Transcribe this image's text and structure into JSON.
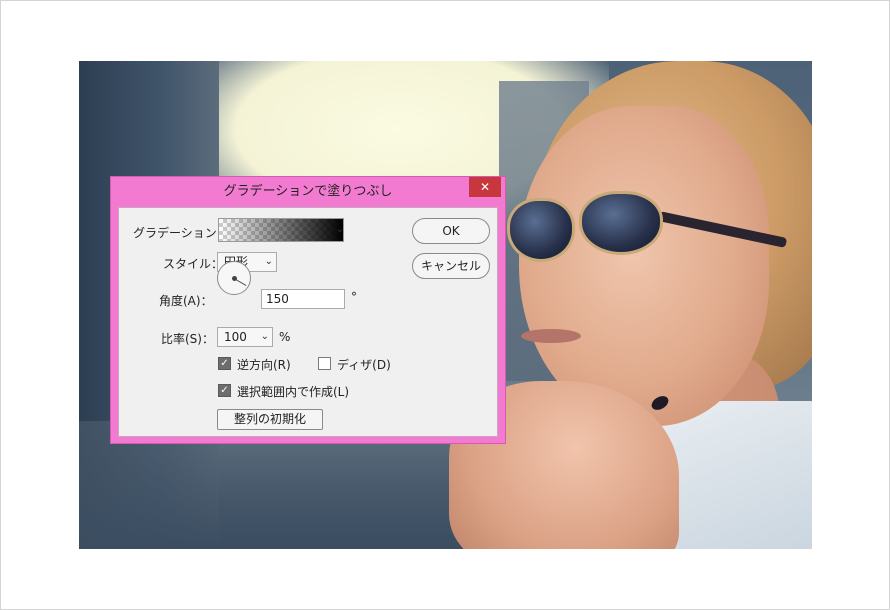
{
  "dialog": {
    "title": "グラデーションで塗りつぶし",
    "close_glyph": "✕",
    "gradient_label": "グラデーション：",
    "style_label": "スタイル：",
    "style_value": "円形",
    "angle_label": "角度(A)：",
    "angle_value": "150",
    "angle_unit": "°",
    "scale_label": "比率(S)：",
    "scale_value": "100",
    "scale_unit": "%",
    "reverse_label": "逆方向(R)",
    "reverse_checked": true,
    "dither_label": "ディザ(D)",
    "dither_checked": false,
    "align_label": "選択範囲内で作成(L)",
    "align_checked": true,
    "reset_label": "整列の初期化",
    "ok_label": "OK",
    "cancel_label": "キャンセル"
  },
  "colors": {
    "titlebar": "#f27ad0",
    "close_button": "#c7373d",
    "client_bg": "#f0f0f0"
  },
  "icons": {
    "dropdown": "chevron-down-icon",
    "check": "checkmark-icon"
  }
}
